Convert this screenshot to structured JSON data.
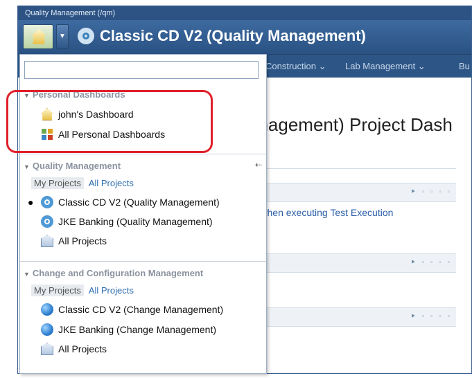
{
  "window": {
    "title": "Quality Management (/qm)",
    "project_title": "Classic CD V2 (Quality Management)"
  },
  "navbar": {
    "items": [
      "Construction ⌄",
      "Lab Management ⌄",
      "Bu"
    ]
  },
  "page": {
    "title": "anagement) Project Dash",
    "link_text": "rt\" when executing Test Execution",
    "widget_tools": [
      "⯈",
      "▫ ▫ ▫ ▫"
    ]
  },
  "search": {
    "value": "",
    "placeholder": ""
  },
  "personal": {
    "heading": "Personal Dashboards",
    "items": [
      {
        "label": "john's Dashboard",
        "icon": "home-icon"
      },
      {
        "label": "All Personal Dashboards",
        "icon": "dashboard-grid-icon"
      }
    ]
  },
  "qm": {
    "heading": "Quality Management",
    "collapse": "⇠",
    "tab_mine": "My Projects",
    "tab_all": "All Projects",
    "items": [
      {
        "label": "Classic CD V2 (Quality Management)",
        "icon": "quality-management-icon",
        "current": true
      },
      {
        "label": "JKE Banking (Quality Management)",
        "icon": "quality-management-icon"
      },
      {
        "label": "All Projects",
        "icon": "all-projects-icon"
      }
    ]
  },
  "ccm": {
    "heading": "Change and Configuration Management",
    "tab_mine": "My Projects",
    "tab_all": "All Projects",
    "items": [
      {
        "label": "Classic CD V2 (Change Management)",
        "icon": "change-management-icon"
      },
      {
        "label": "JKE Banking (Change Management)",
        "icon": "change-management-icon"
      },
      {
        "label": "All Projects",
        "icon": "all-projects-icon"
      }
    ]
  },
  "colors": {
    "banner": "#2c5384",
    "highlight": "#e0202a",
    "link": "#2b6cb0"
  }
}
